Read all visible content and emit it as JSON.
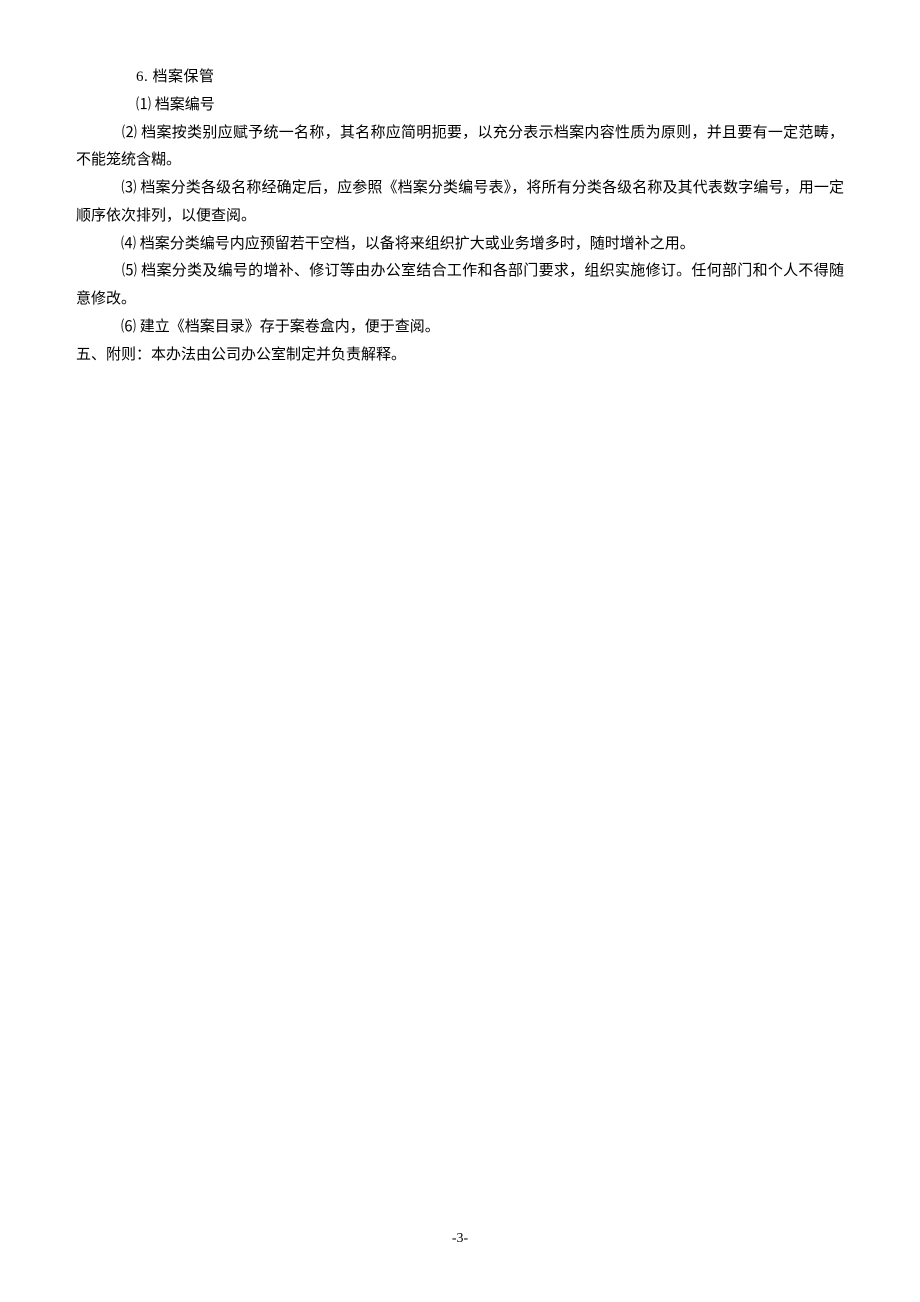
{
  "document": {
    "lines": [
      {
        "cls": "indent-1 line-1",
        "text": "6.  档案保管"
      },
      {
        "cls": "indent-2",
        "text": "⑴ 档案编号"
      },
      {
        "cls": "body-line",
        "text": "　　　⑵ 档案按类别应赋予统一名称，其名称应简明扼要，以充分表示档案内容性质为原则，并且要有一定范畴，不能笼统含糊。"
      },
      {
        "cls": "body-line",
        "text": "　　　⑶ 档案分类各级名称经确定后，应参照《档案分类编号表》，将所有分类各级名称及其代表数字编号，用一定顺序依次排列，以便查阅。"
      },
      {
        "cls": "body-line",
        "text": "　　　⑷ 档案分类编号内应预留若干空档，以备将来组织扩大或业务增多时，随时增补之用。"
      },
      {
        "cls": "body-line",
        "text": "　　　⑸ 档案分类及编号的增补、修订等由办公室结合工作和各部门要求，组织实施修订。任何部门和个人不得随意修改。"
      },
      {
        "cls": "body-line",
        "text": "　　　⑹ 建立《档案目录》存于案卷盒内，便于查阅。"
      },
      {
        "cls": "body-line",
        "text": "五、附则：本办法由公司办公室制定并负责解释。"
      }
    ],
    "page_number": "-3-"
  }
}
